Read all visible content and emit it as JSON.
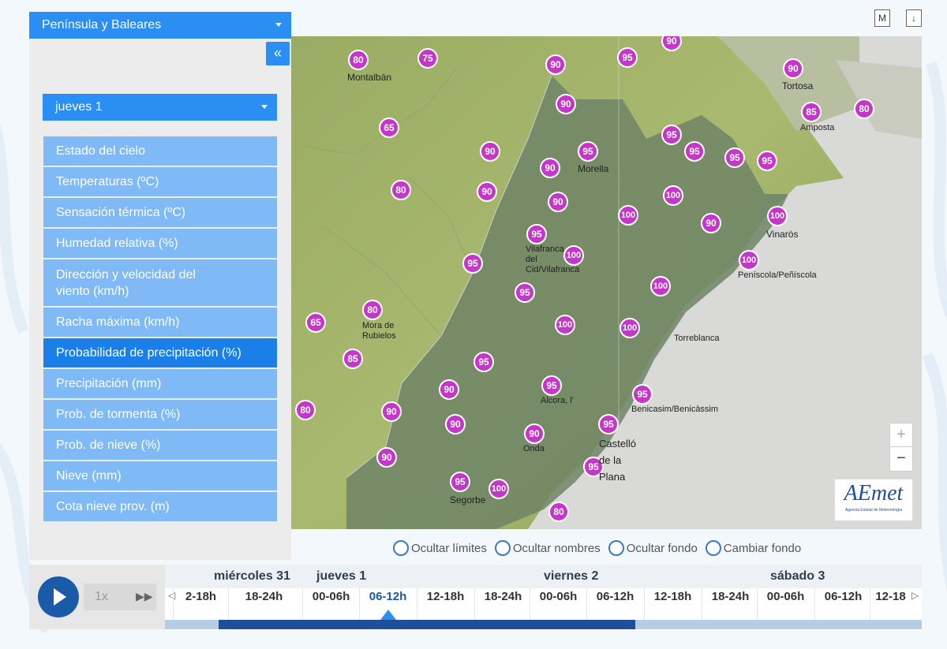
{
  "region": "Península y Baleares",
  "collapse_icon": "«",
  "day": "jueves 1",
  "menu": [
    {
      "label": "Estado del cielo",
      "active": false
    },
    {
      "label": "Temperaturas (ºC)",
      "active": false
    },
    {
      "label": "Sensación térmica (ºC)",
      "active": false
    },
    {
      "label": "Humedad relativa (%)",
      "active": false
    },
    {
      "label": "Dirección y velocidad del viento (km/h)",
      "active": false
    },
    {
      "label": "Racha máxima (km/h)",
      "active": false
    },
    {
      "label": "Probabilidad de precipitación (%)",
      "active": true
    },
    {
      "label": "Precipitación (mm)",
      "active": false
    },
    {
      "label": "Prob. de tormenta (%)",
      "active": false
    },
    {
      "label": "Prob. de nieve (%)",
      "active": false
    },
    {
      "label": "Nieve (mm)",
      "active": false
    },
    {
      "label": "Cota nieve prov. (m)",
      "active": false
    }
  ],
  "top_icons": [
    "M",
    "↓"
  ],
  "map": {
    "markers": [
      "90",
      "80",
      "75",
      "90",
      "95",
      "90",
      "65",
      "90",
      "95",
      "90",
      "95",
      "95",
      "95",
      "95",
      "85",
      "80",
      "80",
      "90",
      "90",
      "100",
      "100",
      "90",
      "100",
      "90",
      "100",
      "95",
      "95",
      "100",
      "80",
      "65",
      "100",
      "100",
      "100",
      "85",
      "95",
      "95",
      "90",
      "80",
      "90",
      "95",
      "90",
      "95",
      "90",
      "95",
      "100",
      "80"
    ],
    "places": [
      "Montalbán",
      "Tortosa",
      "Amposta",
      "Morella",
      "Vinaròs",
      "Vilafranca\ndel\nCid/Vilafranca",
      "Peníscola/Peñíscola",
      "Mora de\nRubielos",
      "Torreblanca",
      "Alcora, l'",
      "Benicasim/Benicàssim",
      "Castelló\nde la\nPlana",
      "Onda",
      "Segorbe"
    ],
    "zoom_in": "+",
    "zoom_out": "−",
    "logo": "AEmet",
    "logo_sub": "Agencia Estatal de Meteorología"
  },
  "options": [
    "Ocultar límites",
    "Ocultar nombres",
    "Ocultar fondo",
    "Cambiar fondo"
  ],
  "player": {
    "speed": "1x",
    "ff_icon": "▶▶"
  },
  "timeline": {
    "days": [
      "miércoles 31",
      "jueves 1",
      "viernes 2",
      "sábado 3"
    ],
    "slots": [
      "2-18h",
      "18-24h",
      "00-06h",
      "06-12h",
      "12-18h",
      "18-24h",
      "00-06h",
      "06-12h",
      "12-18h",
      "18-24h",
      "00-06h",
      "06-12h",
      "12-18"
    ],
    "active_slot_index": 3,
    "left_arrow": "◁",
    "right_arrow": "▷"
  },
  "colors": {
    "accent": "#2a8ef2",
    "menu_item": "#7fbaf7",
    "menu_active": "#1a7fe8",
    "marker": "#c437c8"
  }
}
